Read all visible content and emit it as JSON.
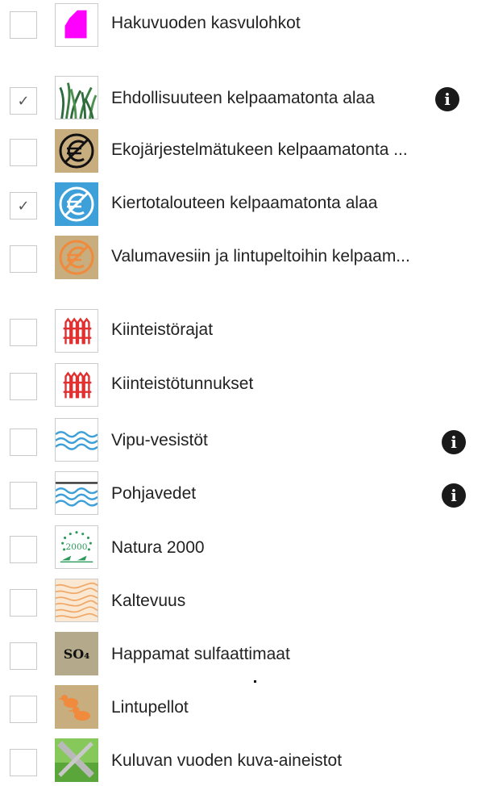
{
  "layers": [
    {
      "id": "hakuvuoden",
      "label": "Hakuvuoden kasvulohkot",
      "checked": false,
      "icon": "magenta-parcel-icon"
    },
    {
      "id": "ehdollisuus",
      "label": "Ehdollisuuteen kelpaamatonta alaa",
      "checked": true,
      "icon": "grass-icon",
      "info": true
    },
    {
      "id": "ekojarjestelma",
      "label": "Ekojärjestelmätukeen kelpaamatonta ...",
      "checked": false,
      "icon": "euro-crossed-black-icon"
    },
    {
      "id": "kiertotalous",
      "label": "Kiertotalouteen kelpaamatonta alaa",
      "checked": true,
      "icon": "euro-crossed-blue-icon"
    },
    {
      "id": "valumavesi",
      "label": "Valumavesiin ja lintupeltoihin kelpaam...",
      "checked": false,
      "icon": "euro-crossed-orange-icon"
    },
    {
      "id": "kiinteistorajat",
      "label": "Kiinteistörajat",
      "checked": false,
      "icon": "red-fence-icon"
    },
    {
      "id": "kiinteistotunnukset",
      "label": "Kiinteistötunnukset",
      "checked": false,
      "icon": "red-fence-icon"
    },
    {
      "id": "vipuvesistot",
      "label": "Vipu-vesistöt",
      "checked": false,
      "icon": "water-waves-icon",
      "info": true
    },
    {
      "id": "pohjavedet",
      "label": "Pohjavedet",
      "checked": false,
      "icon": "groundwater-icon",
      "info": true
    },
    {
      "id": "natura",
      "label": "Natura 2000",
      "checked": false,
      "icon": "natura-2000-icon",
      "icon_text": "2000"
    },
    {
      "id": "kaltevuus",
      "label": "Kaltevuus",
      "checked": false,
      "icon": "contour-lines-icon"
    },
    {
      "id": "happamat",
      "label": "Happamat sulfaattimaat",
      "checked": false,
      "icon": "so4-icon",
      "icon_text": "SO₄"
    },
    {
      "id": "lintupellot",
      "label": "Lintupellot",
      "checked": false,
      "icon": "ducks-icon"
    },
    {
      "id": "kuva",
      "label": "Kuluvan vuoden kuva-aineistot",
      "checked": false,
      "icon": "aerial-image-icon"
    }
  ],
  "check_mark": "✓",
  "info_glyph": "i",
  "colors": {
    "magenta": "#ff00ff",
    "info_bg": "#1a1a1a",
    "checkbox_border": "#c9c9c9",
    "tan": "#c8ad7f",
    "blue": "#3da0d8",
    "orange": "#f08a3c",
    "red": "#e03030",
    "sulfate_bg": "#b4a98a"
  }
}
